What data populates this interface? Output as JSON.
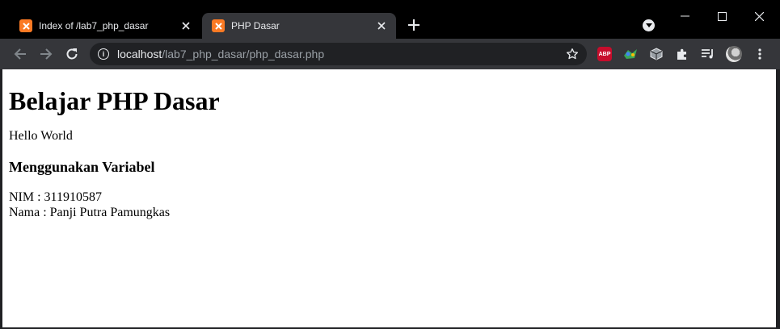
{
  "browser": {
    "tabs": [
      {
        "title": "Index of /lab7_php_dasar",
        "active": false,
        "favicon": "xampp-icon"
      },
      {
        "title": "PHP Dasar",
        "active": true,
        "favicon": "xampp-icon"
      }
    ],
    "address_bar": {
      "host": "localhost",
      "path": "/lab7_php_dasar/php_dasar.php"
    },
    "extensions": [
      "abp-icon",
      "colorful-extension-icon",
      "cube-icon",
      "puzzle-icon",
      "media-queue-icon",
      "profile-avatar"
    ],
    "abp_label": "ABP"
  },
  "page": {
    "heading": "Belajar PHP Dasar",
    "greeting": "Hello World",
    "subheading": "Menggunakan Variabel",
    "nim_line": "NIM : 311910587",
    "nama_line": "Nama : Panji Putra Pamungkas"
  },
  "colors": {
    "tabstrip": "#000000",
    "toolbar": "#35363a",
    "omnibox": "#202124",
    "xampp_orange": "#fb7a24",
    "abp_red": "#c70d2c"
  }
}
